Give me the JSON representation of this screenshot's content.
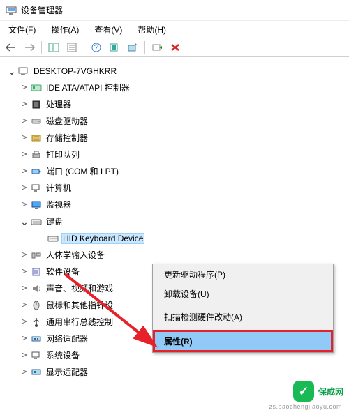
{
  "title": "设备管理器",
  "menu": {
    "file": "文件(F)",
    "action": "操作(A)",
    "view": "查看(V)",
    "help": "帮助(H)"
  },
  "root": "DESKTOP-7VGHKRR",
  "nodes": [
    {
      "label": "IDE ATA/ATAPI 控制器"
    },
    {
      "label": "处理器"
    },
    {
      "label": "磁盘驱动器"
    },
    {
      "label": "存储控制器"
    },
    {
      "label": "打印队列"
    },
    {
      "label": "端口 (COM 和 LPT)"
    },
    {
      "label": "计算机"
    },
    {
      "label": "监视器"
    },
    {
      "label": "键盘",
      "expanded": true
    },
    {
      "label": "人体学输入设备"
    },
    {
      "label": "软件设备"
    },
    {
      "label": "声音、视频和游戏"
    },
    {
      "label": "鼠标和其他指针设"
    },
    {
      "label": "通用串行总线控制"
    },
    {
      "label": "网络适配器"
    },
    {
      "label": "系统设备"
    },
    {
      "label": "显示适配器"
    }
  ],
  "selected": "HID Keyboard Device",
  "context": {
    "update": "更新驱动程序(P)",
    "uninstall": "卸载设备(U)",
    "scan": "扫描检测硬件改动(A)",
    "properties": "属性(R)"
  },
  "watermark": {
    "text": "保成网",
    "sub": "zs.baochengjiaoyu.com"
  }
}
